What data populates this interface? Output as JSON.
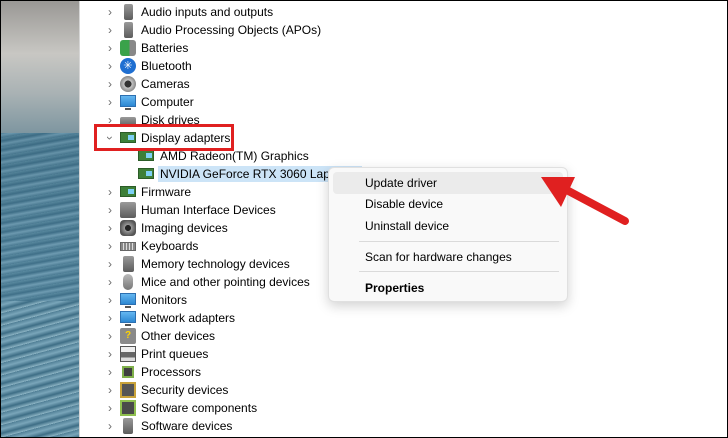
{
  "tree": {
    "categories_top": [
      {
        "label": "Audio inputs and outputs",
        "icon": "speaker-icon"
      },
      {
        "label": "Audio Processing Objects (APOs)",
        "icon": "speaker-icon"
      },
      {
        "label": "Batteries",
        "icon": "battery-icon"
      },
      {
        "label": "Bluetooth",
        "icon": "bluetooth-icon"
      },
      {
        "label": "Cameras",
        "icon": "camera-icon"
      },
      {
        "label": "Computer",
        "icon": "monitor-icon"
      },
      {
        "label": "Disk drives",
        "icon": "disk-icon"
      }
    ],
    "expanded": {
      "label": "Display adapters",
      "icon": "display-adapter-icon"
    },
    "children": [
      {
        "label": "AMD Radeon(TM) Graphics"
      },
      {
        "label": "NVIDIA GeForce RTX 3060 Lapto"
      }
    ],
    "categories_bottom": [
      {
        "label": "Firmware"
      },
      {
        "label": "Human Interface Devices"
      },
      {
        "label": "Imaging devices"
      },
      {
        "label": "Keyboards"
      },
      {
        "label": "Memory technology devices"
      },
      {
        "label": "Mice and other pointing devices"
      },
      {
        "label": "Monitors"
      },
      {
        "label": "Network adapters"
      },
      {
        "label": "Other devices"
      },
      {
        "label": "Print queues"
      },
      {
        "label": "Processors"
      },
      {
        "label": "Security devices"
      },
      {
        "label": "Software components"
      },
      {
        "label": "Software devices"
      }
    ]
  },
  "context_menu": {
    "update": "Update driver",
    "disable": "Disable device",
    "uninstall": "Uninstall device",
    "scan": "Scan for hardware changes",
    "properties": "Properties"
  },
  "colors": {
    "highlight": "#e02020",
    "selection": "#cce4f7"
  }
}
